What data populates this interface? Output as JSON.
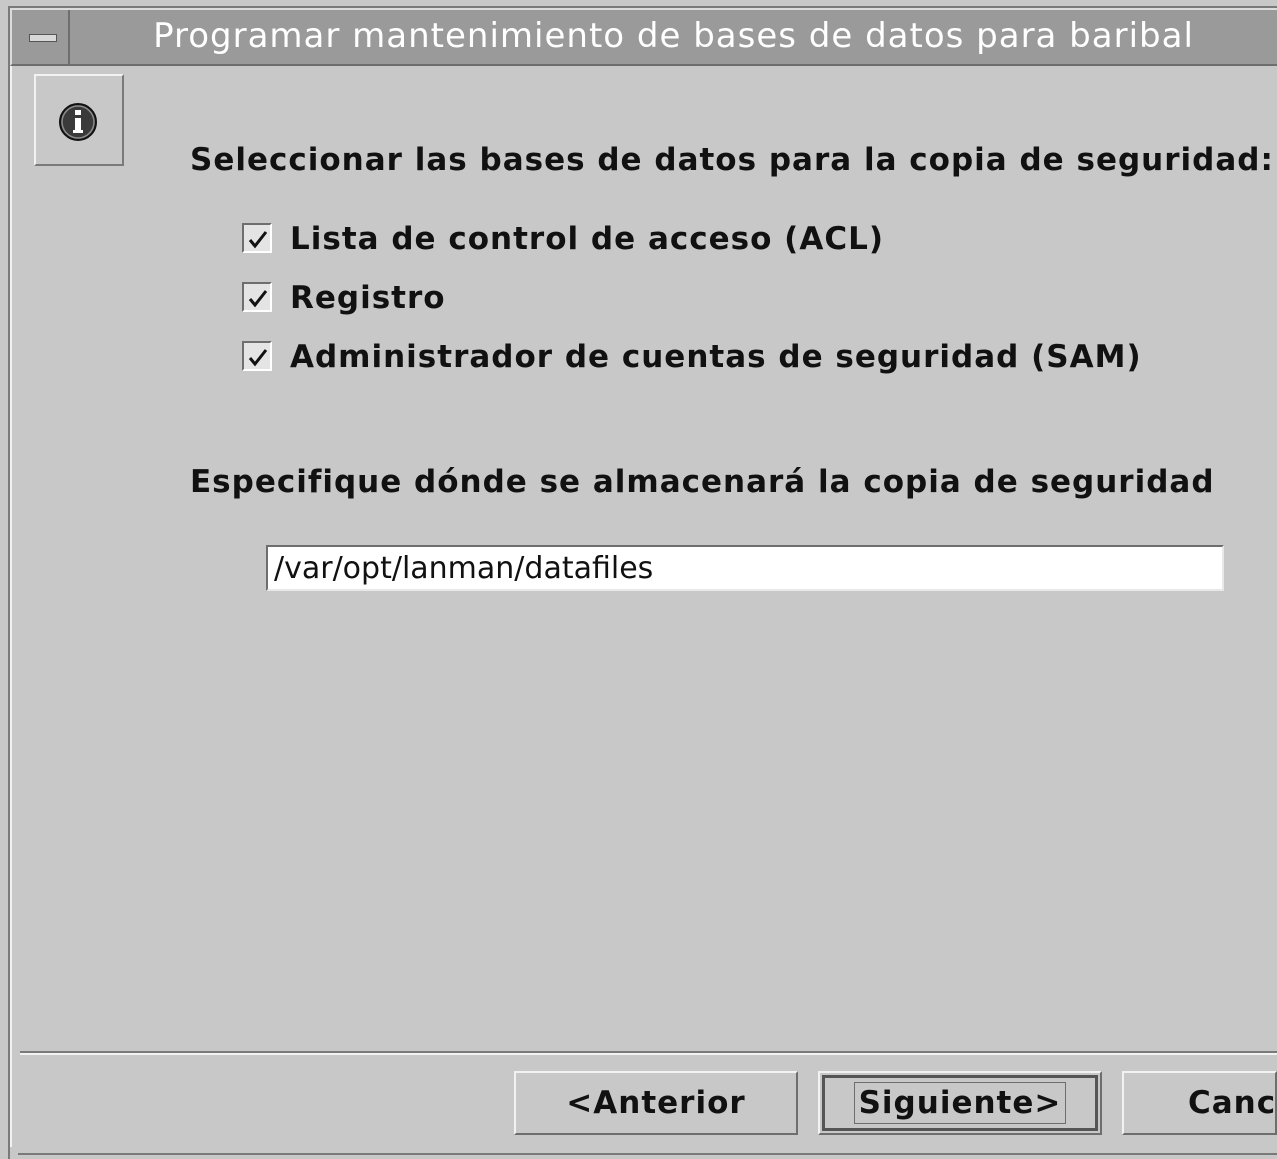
{
  "window": {
    "title": "Programar mantenimiento de bases de datos para baribal"
  },
  "icons": {
    "window_menu": "window-menu-icon",
    "info": "info-icon"
  },
  "databases": {
    "heading": "Seleccionar las bases de datos para la copia de seguridad:",
    "items": [
      {
        "label": "Lista de control de acceso (ACL)",
        "checked": true
      },
      {
        "label": "Registro",
        "checked": true
      },
      {
        "label": "Administrador de cuentas de seguridad (SAM)",
        "checked": true
      }
    ]
  },
  "location": {
    "heading": "Especifique dónde se almacenará la copia de seguridad",
    "path_value": "/var/opt/lanman/datafiles"
  },
  "buttons": {
    "back_label": "<Anterior",
    "next_label": "Siguiente>",
    "cancel_label": "Canc"
  },
  "colors": {
    "background": "#c8c8c8",
    "titlebar": "#9a9a9a",
    "title_text": "#ffffff"
  }
}
